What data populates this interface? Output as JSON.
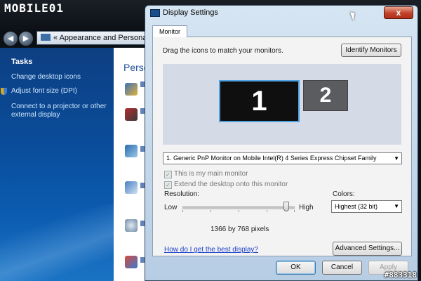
{
  "brand": "MOBILE01",
  "watermark": "#883318",
  "explorer": {
    "address_prefix": "«",
    "address_text": "Appearance and Personalization",
    "tasks_heading": "Tasks",
    "tasks": [
      "Change desktop icons",
      "Adjust font size (DPI)",
      "Connect to a projector or other external display"
    ],
    "content_heading_partial": "Perso"
  },
  "dialog": {
    "title": "Display Settings",
    "tab": "Monitor",
    "instruction": "Drag the icons to match your monitors.",
    "identify_button": "Identify Monitors",
    "monitor_1_label": "1",
    "monitor_2_label": "2",
    "monitor_select": "1. Generic PnP Monitor on Mobile Intel(R) 4 Series Express Chipset Family",
    "checkbox_main": "This is my main monitor",
    "checkbox_extend": "Extend the desktop onto this monitor",
    "resolution_label": "Resolution:",
    "low_label": "Low",
    "high_label": "High",
    "resolution_value": "1366 by 768 pixels",
    "resolution_slider_level": 0.95,
    "colors_label": "Colors:",
    "colors_select": "Highest (32 bit)",
    "help_link": "How do I get the best display?",
    "advanced_button": "Advanced Settings...",
    "ok_button": "OK",
    "cancel_button": "Cancel",
    "apply_button": "Apply",
    "close_glyph": "x"
  },
  "colors": {
    "monitor_selected_border": "#4fa3e3",
    "task_pane_blue": "#0a4c99",
    "link_blue": "#1a3fc7"
  }
}
